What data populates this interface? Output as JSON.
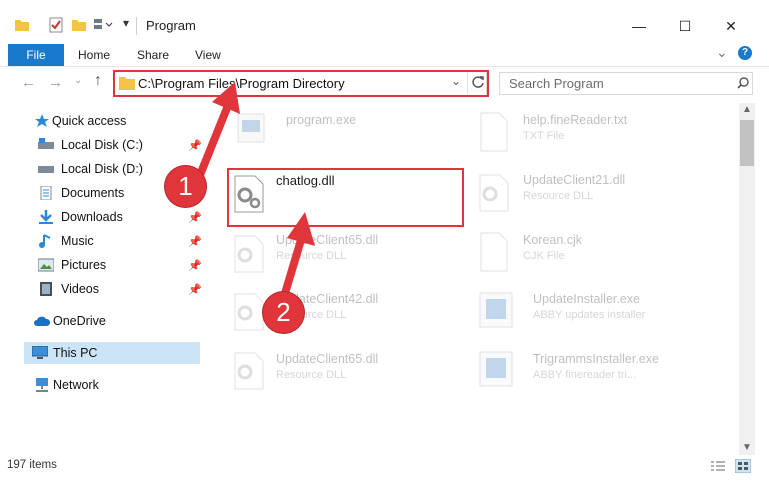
{
  "window": {
    "title": "Program",
    "minimize": "—",
    "maximize": "☐",
    "close": "✕"
  },
  "ribbon": {
    "tabs": [
      "File",
      "Home",
      "Share",
      "View"
    ],
    "expand": "⌄",
    "help": "?"
  },
  "address": {
    "path": "C:\\Program Files\\Program Directory"
  },
  "search": {
    "placeholder": "Search Program"
  },
  "sidebar": {
    "items": [
      {
        "label": "Quick access"
      },
      {
        "label": "Local Disk (C:)"
      },
      {
        "label": "Local Disk (D:)"
      },
      {
        "label": "Documents"
      },
      {
        "label": "Downloads"
      },
      {
        "label": "Music"
      },
      {
        "label": "Pictures"
      },
      {
        "label": "Videos"
      },
      {
        "label": "OneDrive"
      },
      {
        "label": "This PC"
      },
      {
        "label": "Network"
      }
    ]
  },
  "files": [
    {
      "name": "program.exe",
      "type": ""
    },
    {
      "name": "help.fineReader.txt",
      "type": "TXT File"
    },
    {
      "name": "chatlog.dll",
      "type": ""
    },
    {
      "name": "UpdateClient21.dll",
      "type": "Resource DLL"
    },
    {
      "name": "UpdateClient65.dll",
      "type": "Resource DLL"
    },
    {
      "name": "Korean.cjk",
      "type": "CJK File"
    },
    {
      "name": "UpdateClient42.dll",
      "type": "Resource DLL"
    },
    {
      "name": "UpdateInstaller.exe",
      "type": "ABBY updates installer"
    },
    {
      "name": "UpdateClient65.dll",
      "type": "Resource DLL"
    },
    {
      "name": "TrigrammsInstaller.exe",
      "type": "ABBY finereader tri..."
    }
  ],
  "status": {
    "count": "197 items"
  },
  "annotations": {
    "step1": "1",
    "step2": "2",
    "accent": "#e0353b"
  }
}
